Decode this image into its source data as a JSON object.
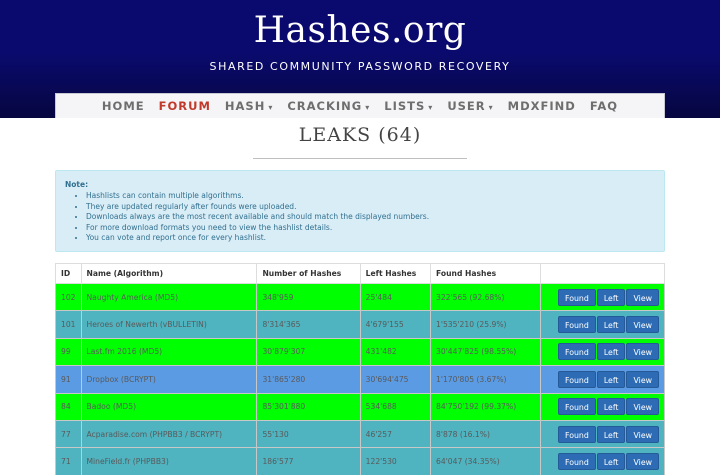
{
  "site": {
    "title": "Hashes.org",
    "tagline": "SHARED COMMUNITY PASSWORD RECOVERY"
  },
  "nav": {
    "items": [
      {
        "label": "HOME",
        "dropdown": false,
        "active": false
      },
      {
        "label": "FORUM",
        "dropdown": false,
        "active": true
      },
      {
        "label": "HASH",
        "dropdown": true,
        "active": false
      },
      {
        "label": "CRACKING",
        "dropdown": true,
        "active": false
      },
      {
        "label": "LISTS",
        "dropdown": true,
        "active": false
      },
      {
        "label": "USER",
        "dropdown": true,
        "active": false
      },
      {
        "label": "MDXFIND",
        "dropdown": false,
        "active": false
      },
      {
        "label": "FAQ",
        "dropdown": false,
        "active": false
      }
    ]
  },
  "page": {
    "title": "LEAKS (64)"
  },
  "note": {
    "label": "Note:",
    "items": [
      "Hashlists can contain multiple algorithms.",
      "They are updated regularly after founds were uploaded.",
      "Downloads always are the most recent available and should match the displayed numbers.",
      "For more download formats you need to view the hashlist details.",
      "You can vote and report once for every hashlist."
    ]
  },
  "table": {
    "headers": {
      "id": "ID",
      "name": "Name (Algorithm)",
      "hashes": "Number of Hashes",
      "left": "Left Hashes",
      "found": "Found Hashes"
    },
    "buttons": {
      "found": "Found",
      "left": "Left",
      "view": "View"
    },
    "rows": [
      {
        "id": "102",
        "name": "Naughty America (MD5)",
        "hashes": "348'959",
        "left": "25'484",
        "found": "322'565 (92.68%)",
        "color": "green"
      },
      {
        "id": "101",
        "name": "Heroes of Newerth (vBULLETIN)",
        "hashes": "8'314'365",
        "left": "4'679'155",
        "found": "1'535'210 (25.9%)",
        "color": "teal"
      },
      {
        "id": "99",
        "name": "Last.fm 2016 (MD5)",
        "hashes": "30'879'307",
        "left": "431'482",
        "found": "30'447'825 (98.55%)",
        "color": "green"
      },
      {
        "id": "91",
        "name": "Dropbox (BCRYPT)",
        "hashes": "31'865'280",
        "left": "30'694'475",
        "found": "1'170'805 (3.67%)",
        "color": "blue"
      },
      {
        "id": "84",
        "name": "Badoo (MD5)",
        "hashes": "85'301'880",
        "left": "534'688",
        "found": "84'750'192 (99.37%)",
        "color": "green"
      },
      {
        "id": "77",
        "name": "Acparadise.com (PHPBB3 / BCRYPT)",
        "hashes": "55'130",
        "left": "46'257",
        "found": "8'878 (16.1%)",
        "color": "teal"
      },
      {
        "id": "71",
        "name": "MineField.fr (PHPBB3)",
        "hashes": "186'577",
        "left": "122'530",
        "found": "64'047 (34.35%)",
        "color": "teal"
      }
    ]
  },
  "colors": {
    "header_bg": "#0a0a6e",
    "nav_active": "#c0392b",
    "row_green": "#00ff00",
    "row_teal": "#4fb3c0",
    "row_blue": "#5b9be3",
    "button": "#2d6cb5",
    "note_bg": "#d9edf7"
  }
}
